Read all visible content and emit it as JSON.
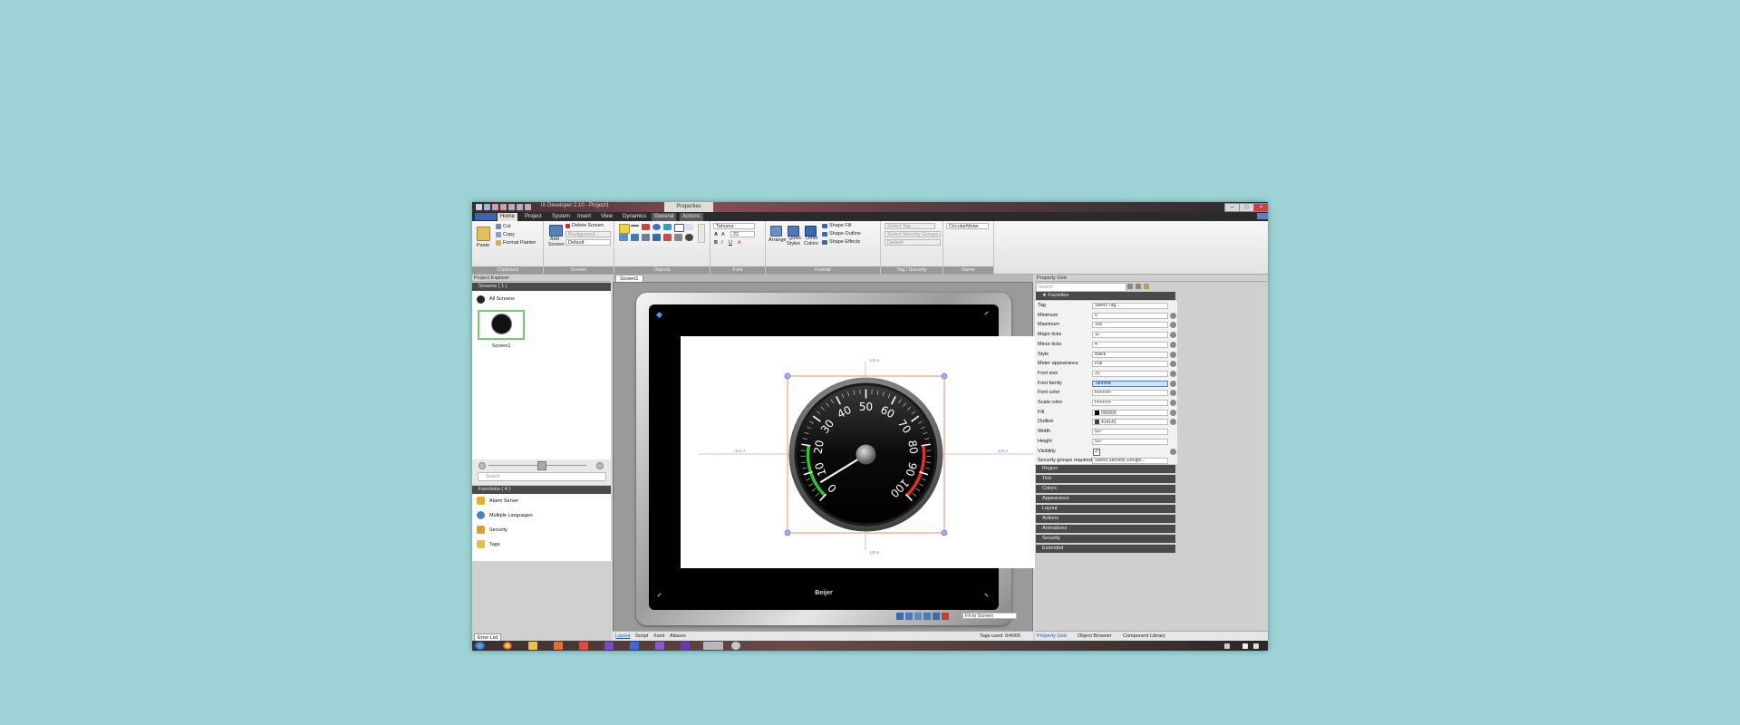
{
  "window": {
    "title": "iX Developer 2.10 - Project1",
    "context_tab": "Properties"
  },
  "ribbon": {
    "tabs": [
      "Home",
      "Project",
      "System",
      "Insert",
      "View",
      "Dynamics",
      "General",
      "Actions"
    ],
    "active_tab": "Home",
    "clipboard": {
      "paste": "Paste",
      "cut": "Cut",
      "copy": "Copy",
      "format_painter": "Format Painter",
      "label": "Clipboard"
    },
    "screen": {
      "add_screen_line1": "Add",
      "add_screen_line2": "Screen",
      "delete_screen": "Delete Screen",
      "background": "Background...",
      "default": "Default",
      "label": "Screen"
    },
    "objects": {
      "label": "Objects"
    },
    "font": {
      "family": "Tahoma",
      "size": "22",
      "label": "Font"
    },
    "format": {
      "arrange": "Arrange",
      "quick_styles_line1": "Quick",
      "quick_styles_line2": "Styles",
      "other_colors_line1": "Other",
      "other_colors_line2": "Colors",
      "shape_fill": "Shape Fill",
      "shape_outline": "Shape Outline",
      "shape_effects": "Shape Effects",
      "label": "Format"
    },
    "tag_security": {
      "select_tag": "Select Tag...",
      "select_security": "Select Security Groups...",
      "default": "Default",
      "label": "Tag / Security"
    },
    "name": {
      "value": "CircularMeter",
      "label": "Name"
    }
  },
  "project_explorer": {
    "title": "Project Explorer",
    "screens_header": "Screens ( 1 )",
    "all_screens": "All Screens",
    "screen_name": "Screen1",
    "search_placeholder": "Search",
    "functions_header": "Functions ( 4 )",
    "functions": [
      "Alarm Server",
      "Multiple Languages",
      "Security",
      "Tags"
    ],
    "error_list": "Error List"
  },
  "editor": {
    "doc_tab": "Screen1",
    "bottom_tabs": [
      "Layout",
      "Script",
      "Xaml",
      "Aliases"
    ],
    "zoom": "Fit to Screen",
    "tags_used": "Tags used: 0/4000",
    "brand": "Beijer",
    "guides": {
      "top": "146.4",
      "bottom": "126.6",
      "left": "374.7",
      "right": "376.2"
    }
  },
  "gauge": {
    "labels": [
      "0",
      "10",
      "20",
      "30",
      "40",
      "50",
      "60",
      "70",
      "80",
      "90",
      "100"
    ],
    "minimum": 0,
    "maximum": 100,
    "value": 5
  },
  "property_grid": {
    "title": "Property Grid",
    "search_placeholder": "Search",
    "favorites": "Favorites",
    "rows": [
      {
        "label": "Tag",
        "value": "Select Tag..."
      },
      {
        "label": "Minimum",
        "value": "0"
      },
      {
        "label": "Maximum",
        "value": "100"
      },
      {
        "label": "Major ticks",
        "value": "11"
      },
      {
        "label": "Minor ticks",
        "value": "4"
      },
      {
        "label": "Style",
        "value": "Black"
      },
      {
        "label": "Meter appearance",
        "value": "Full"
      },
      {
        "label": "Font size",
        "value": "22"
      },
      {
        "label": "Font family",
        "value": "Tahoma"
      },
      {
        "label": "Font color",
        "value": "FFFFFF"
      },
      {
        "label": "Scale color",
        "value": "FFFFFF"
      },
      {
        "label": "Fill",
        "value": "000000"
      },
      {
        "label": "Outline",
        "value": "414141"
      },
      {
        "label": "Width",
        "value": "527"
      },
      {
        "label": "Height",
        "value": "527"
      },
      {
        "label": "Visibility",
        "value": ""
      },
      {
        "label": "Security groups required",
        "value": "Select Security Groups..."
      }
    ],
    "categories": [
      "Region",
      "Text",
      "Colors",
      "Appearance",
      "Layout",
      "Actions",
      "Animations",
      "Security",
      "Extended"
    ],
    "bottom_tabs": [
      "Property Grid",
      "Object Browser",
      "Component Library"
    ]
  },
  "colors": {
    "accent_red": "#e03030",
    "accent_green": "#30c030",
    "selection": "#f08040"
  }
}
